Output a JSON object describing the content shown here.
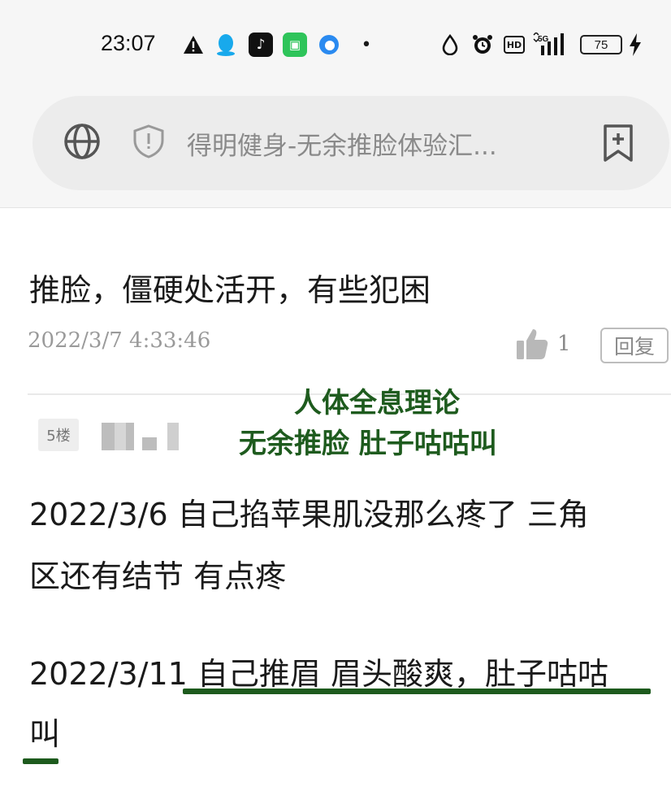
{
  "status_bar": {
    "time": "23:07",
    "battery_level": "75",
    "network": "5G",
    "hd_label": "HD",
    "icons": [
      "warning-icon",
      "qq-icon",
      "tiktok-icon",
      "message-icon",
      "browser-icon",
      "notification-dot-icon",
      "drop-icon",
      "alarm-icon",
      "hd-icon",
      "signal-icon",
      "battery-icon",
      "charging-icon"
    ]
  },
  "address_bar": {
    "page_title": "得明健身-无余推脸体验汇...",
    "icons": [
      "globe-icon",
      "shield-icon",
      "bookmark-add-icon"
    ]
  },
  "post": {
    "text": "推脸，僵硬处活开，有些犯困",
    "timestamp": "2022/3/7 4:33:46",
    "like_count": "1",
    "reply_label": "回复"
  },
  "next_post": {
    "floor_label": "5楼",
    "annotation_line1": "人体全息理论",
    "annotation_line2": "无余推脸 肚子咕咕叫",
    "para1_line1": "2022/3/6 自己掐苹果肌没那么疼了 三角",
    "para1_line2": "区还有结节 有点疼",
    "para2_line1": "2022/3/11 自己推眉 眉头酸爽，肚子咕咕",
    "para2_line2": "叫"
  },
  "colors": {
    "annotation": "#1e5b1e",
    "underline": "#1d5a1d",
    "status_bg": "#f6f6f6",
    "pill_bg": "#ececec"
  }
}
